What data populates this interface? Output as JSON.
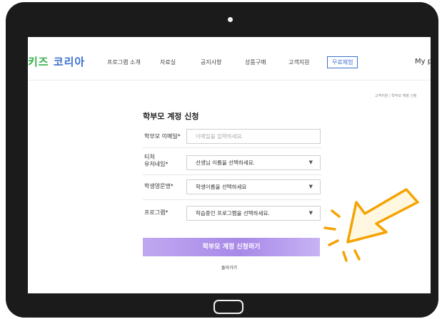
{
  "colors": {
    "tablet_frame": "#1b1b1b",
    "brand": "#3c6ecf",
    "submit_button": "#a889e8",
    "annotation": "#f5a300"
  },
  "nav": {
    "logo_part1": "키즈",
    "logo_part2": " 코리아",
    "items": [
      "프로그램 소개",
      "자료실",
      "공지사항",
      "상품구매",
      "고객지원"
    ],
    "trial_label": "무료체험",
    "mypage_label": "My pa"
  },
  "breadcrumb": "고객지원 / 학부모 계정 신청",
  "form": {
    "title": "학부모 계정 신청",
    "email": {
      "label": "학부모 이메일*",
      "placeholder": "이메일을 입력하세요."
    },
    "teacher": {
      "label_line1": "티쳐",
      "label_line2": "유저네임*",
      "selected": "선생님 이름을 선택하세요."
    },
    "student": {
      "label": "학생영문명*",
      "selected": "학생이름을 선택하세요"
    },
    "program": {
      "label": "프로그램*",
      "selected": "학습중인 프로그램을 선택하세요."
    },
    "submit_label": "학부모 계정 신청하기",
    "back_label": "돌아가기"
  },
  "icons": {
    "dropdown": "chevron-down-icon",
    "pointer": "cursor-arrow-icon"
  }
}
